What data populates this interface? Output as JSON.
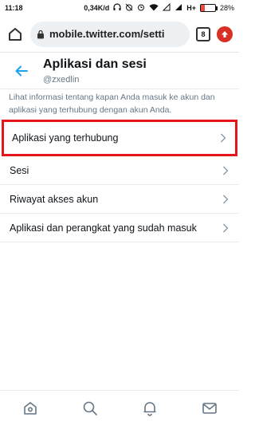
{
  "status_bar": {
    "time": "11:18",
    "network_speed": "0,34K/d",
    "network_type": "H+",
    "battery_percent": "28%",
    "battery_level": 0.28,
    "icons": [
      "headphones-icon",
      "alarm-off-icon",
      "alarm-icon",
      "wifi-icon",
      "sim-no-signal-icon",
      "signal-icon"
    ]
  },
  "browser": {
    "url": "mobile.twitter.com/setti",
    "tab_count": "8"
  },
  "header": {
    "title": "Aplikasi dan sesi",
    "subtitle": "@zxedlin"
  },
  "description": "Lihat informasi tentang kapan Anda masuk ke akun dan aplikasi yang terhubung dengan akun Anda.",
  "menu": {
    "items": [
      {
        "label": "Aplikasi yang terhubung"
      },
      {
        "label": "Sesi"
      },
      {
        "label": "Riwayat akses akun"
      },
      {
        "label": "Aplikasi dan perangkat yang sudah masuk"
      }
    ]
  },
  "colors": {
    "accent": "#1da1f2",
    "highlight": "#e3161c",
    "muted_text": "#657786",
    "text": "#0f1419"
  },
  "bottom_nav": [
    "home-icon",
    "search-icon",
    "notifications-icon",
    "messages-icon"
  ]
}
